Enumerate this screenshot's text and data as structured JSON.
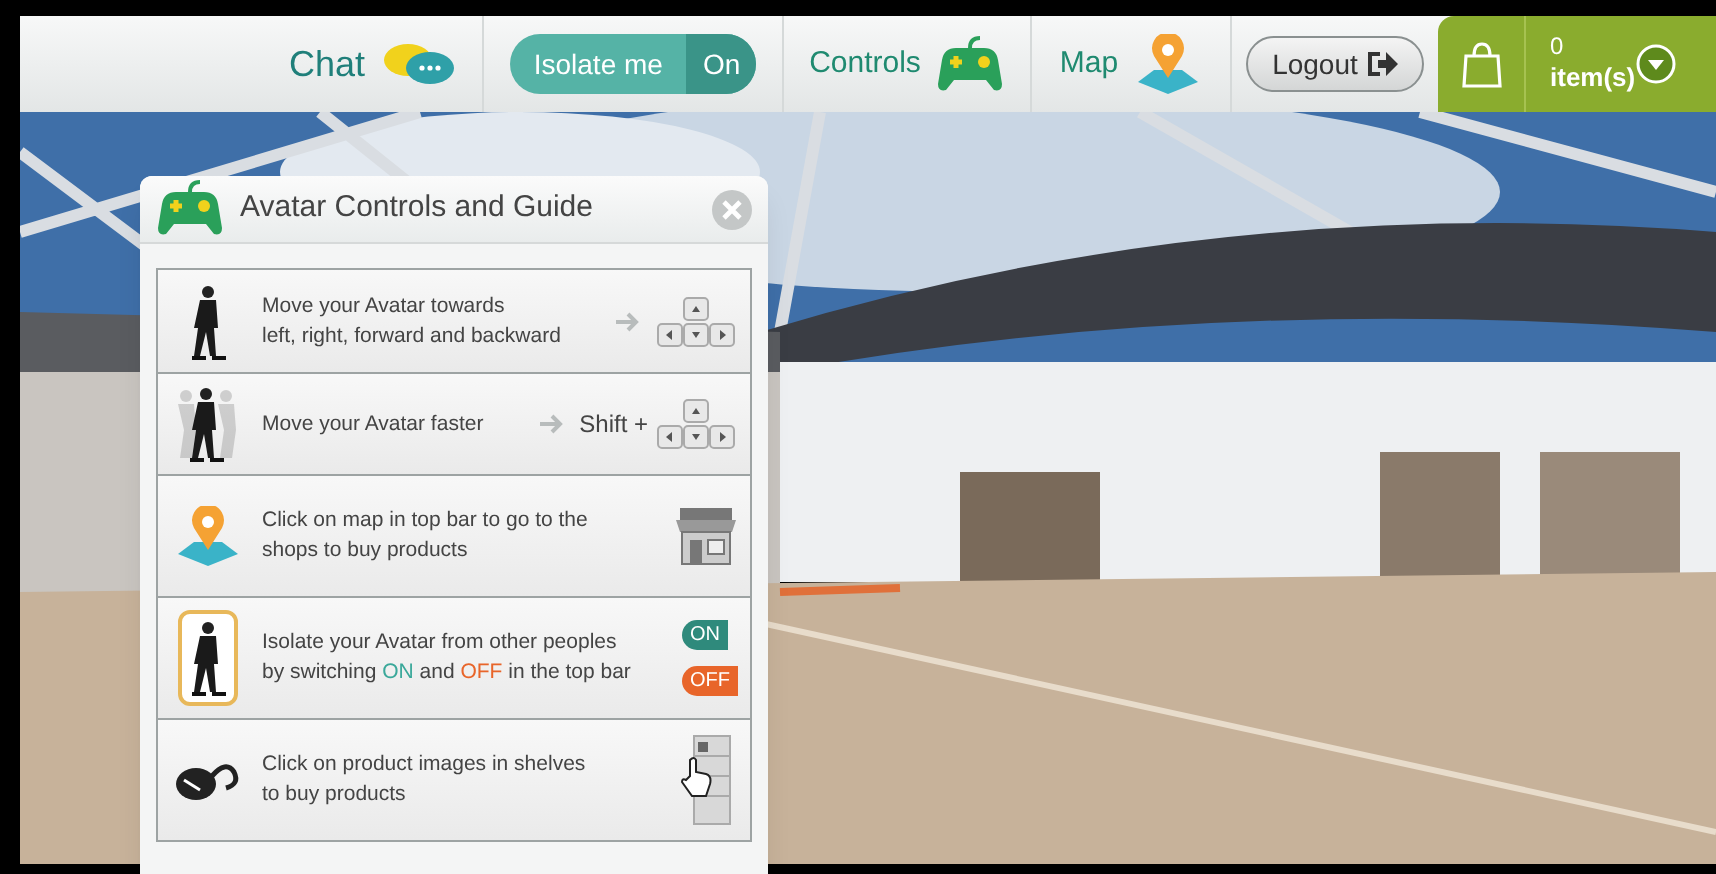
{
  "topbar": {
    "chat_label": "Chat",
    "isolate": {
      "label": "Isolate me",
      "state": "On",
      "on": true
    },
    "controls_label": "Controls",
    "map_label": "Map",
    "logout_label": "Logout",
    "cart": {
      "count": "0",
      "unit": "item(s)"
    }
  },
  "panel": {
    "title": "Avatar Controls and Guide",
    "rows": [
      {
        "kind": "move",
        "lines": [
          [
            {
              "text": "Move your Avatar towards",
              "kind": "plain"
            }
          ],
          [
            {
              "text": "left, right, forward and backward",
              "kind": "plain"
            }
          ]
        ]
      },
      {
        "kind": "fast",
        "modifier": "Shift +",
        "lines": [
          [
            {
              "text": "Move your Avatar faster",
              "kind": "plain"
            }
          ]
        ]
      },
      {
        "kind": "map",
        "lines": [
          [
            {
              "text": "Click on map in top bar to go to the",
              "kind": "plain"
            }
          ],
          [
            {
              "text": "shops to buy products",
              "kind": "plain"
            }
          ]
        ]
      },
      {
        "kind": "isolate",
        "badges": [
          "ON",
          "OFF"
        ],
        "lines": [
          [
            {
              "text": "Isolate your Avatar from other peoples",
              "kind": "plain"
            }
          ],
          [
            {
              "text": "by switching ",
              "kind": "plain"
            },
            {
              "text": "ON",
              "kind": "on"
            },
            {
              "text": " and ",
              "kind": "plain"
            },
            {
              "text": "OFF",
              "kind": "off"
            },
            {
              "text": " in the top bar",
              "kind": "plain"
            }
          ]
        ]
      },
      {
        "kind": "shelf",
        "lines": [
          [
            {
              "text": "Click on product images in shelves",
              "kind": "plain"
            }
          ],
          [
            {
              "text": "to buy products",
              "kind": "plain"
            }
          ]
        ]
      }
    ]
  }
}
